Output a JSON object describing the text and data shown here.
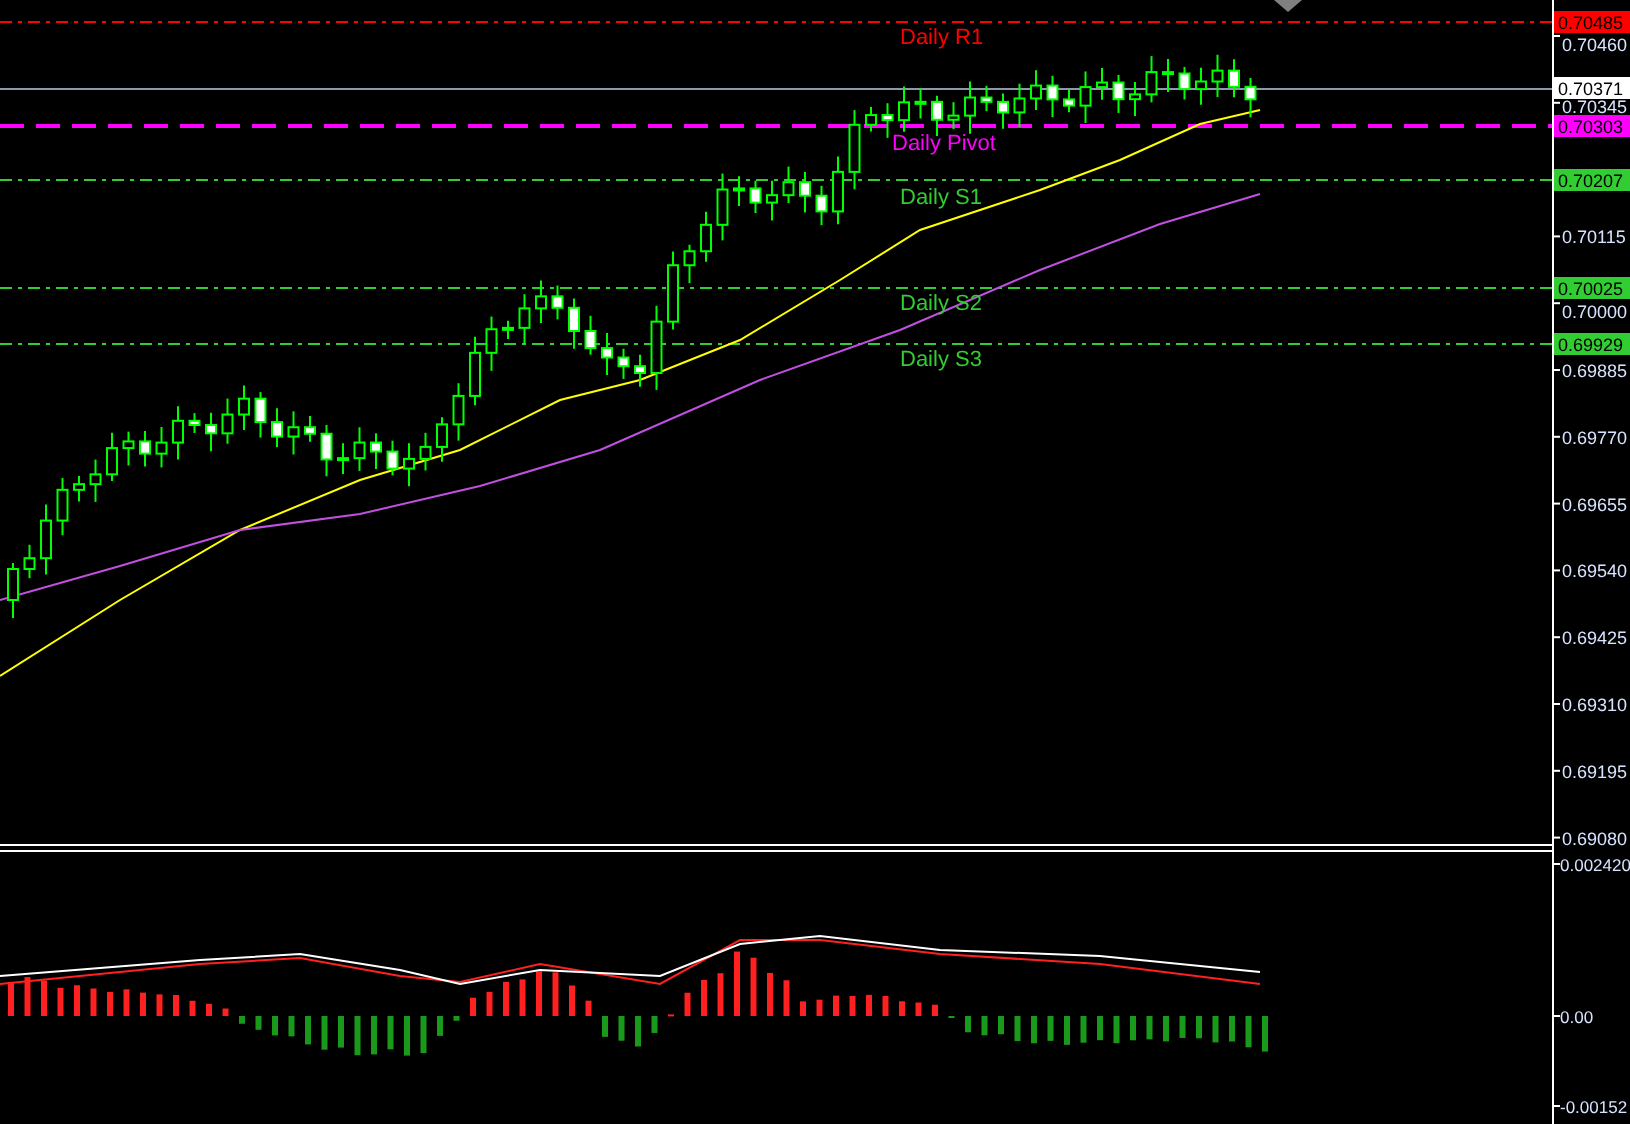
{
  "price_axis": {
    "labels": [
      "0.70460",
      "0.70345",
      "0.70115",
      "0.70000",
      "0.69885",
      "0.69770",
      "0.69655",
      "0.69540",
      "0.69425",
      "0.69310",
      "0.69195",
      "0.69080"
    ]
  },
  "price_markers": [
    {
      "text": "0.70485",
      "color": "#ff0000"
    },
    {
      "text": "0.70371",
      "color": "#ffffff"
    },
    {
      "text": "0.70303",
      "color": "#ff00ff"
    },
    {
      "text": "0.70207",
      "color": "#32cd32"
    },
    {
      "text": "0.70025",
      "color": "#32cd32"
    },
    {
      "text": "0.69929",
      "color": "#32cd32"
    }
  ],
  "levels": [
    {
      "label": "Daily R1",
      "color": "#ff0000"
    },
    {
      "label": "Daily Pivot",
      "color": "#ff00ff"
    },
    {
      "label": "Daily S1",
      "color": "#32cd32"
    },
    {
      "label": "Daily S2",
      "color": "#32cd32"
    },
    {
      "label": "Daily S3",
      "color": "#32cd32"
    }
  ],
  "indicator_axis": {
    "labels": [
      "0.002420",
      "0.00",
      "-0.00152"
    ]
  }
}
